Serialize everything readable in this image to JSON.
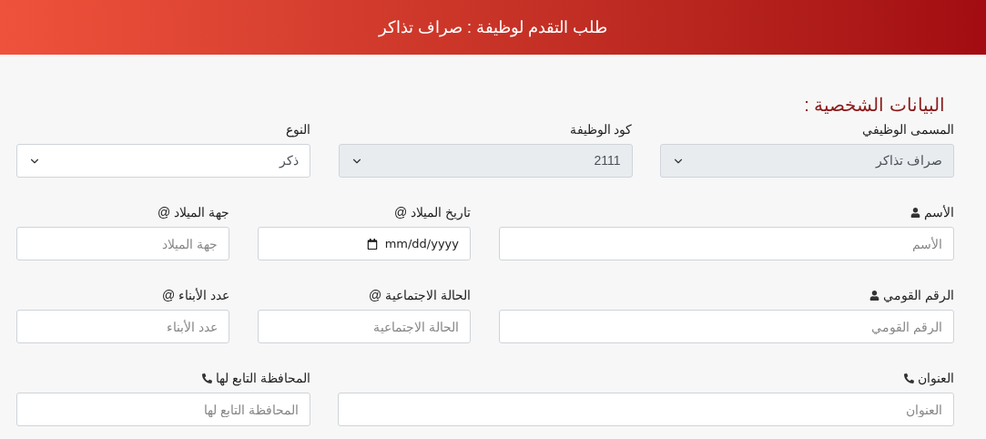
{
  "header": {
    "title": "طلب التقدم لوظيفة : صراف تذاكر"
  },
  "section": {
    "title": "البيانات الشخصية :"
  },
  "rows": [
    [
      {
        "kind": "select",
        "label": "المسمى الوظيفي",
        "value": "صراف تذاكر",
        "disabled": true
      },
      {
        "kind": "select",
        "label": "كود الوظيفة",
        "value": "2111",
        "disabled": true
      },
      {
        "kind": "select",
        "label": "النوع",
        "value": "ذكر",
        "disabled": false
      }
    ],
    [
      {
        "kind": "text",
        "label": "الأسم",
        "placeholder": "الأسم"
      },
      {
        "kind": "date",
        "label": "تاريخ الميلاد @",
        "placeholder": "mm/dd/yyyy"
      },
      {
        "kind": "text",
        "label": "جهة الميلاد @",
        "placeholder": "جهة الميلاد"
      }
    ],
    [
      {
        "kind": "text",
        "label": "الرقم القومي",
        "placeholder": "الرقم القومي"
      },
      {
        "kind": "text",
        "label": "الحالة الاجتماعية @",
        "placeholder": "الحالة الاجتماعية"
      },
      {
        "kind": "text",
        "label": "عدد الأبناء @",
        "placeholder": "عدد الأبناء"
      }
    ],
    [
      {
        "kind": "text",
        "label": "العنوان",
        "placeholder": "العنوان"
      },
      {
        "kind": "text",
        "label": "المحافظة التابع لها",
        "placeholder": "المحافظة التابع لها"
      }
    ]
  ]
}
